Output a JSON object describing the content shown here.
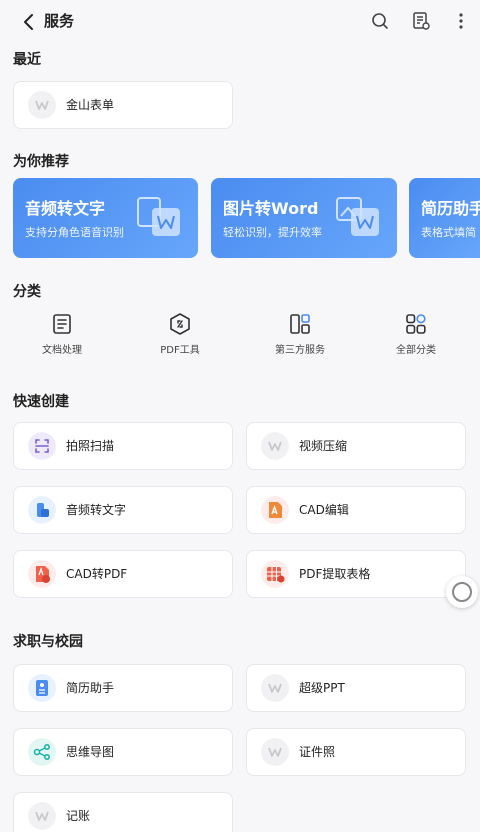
{
  "header": {
    "title": "服务"
  },
  "sections": {
    "recent": "最近",
    "recommend": "为你推荐",
    "category": "分类",
    "quick": "快速创建",
    "career": "求职与校园"
  },
  "recent": [
    {
      "label": "金山表单",
      "icon": "wps-logo-icon"
    }
  ],
  "recommend": [
    {
      "title": "音频转文字",
      "subtitle": "支持分角色语音识别"
    },
    {
      "title": "图片转Word",
      "subtitle": "轻松识别，提升效率"
    },
    {
      "title": "简历助手",
      "subtitle": "表格式填简"
    }
  ],
  "categories": [
    {
      "label": "文档处理",
      "icon": "document-icon"
    },
    {
      "label": "PDF工具",
      "icon": "pdf-tool-icon"
    },
    {
      "label": "第三方服务",
      "icon": "third-party-icon"
    },
    {
      "label": "全部分类",
      "icon": "grid-icon"
    }
  ],
  "quick": [
    {
      "label": "拍照扫描",
      "icon": "scan-icon"
    },
    {
      "label": "视频压缩",
      "icon": "wps-logo-icon"
    },
    {
      "label": "音频转文字",
      "icon": "audio-icon"
    },
    {
      "label": "CAD编辑",
      "icon": "cad-edit-icon"
    },
    {
      "label": "CAD转PDF",
      "icon": "cad-pdf-icon"
    },
    {
      "label": "PDF提取表格",
      "icon": "table-icon"
    }
  ],
  "career": [
    {
      "label": "简历助手",
      "icon": "resume-icon"
    },
    {
      "label": "超级PPT",
      "icon": "wps-logo-icon"
    },
    {
      "label": "思维导图",
      "icon": "mindmap-icon"
    },
    {
      "label": "证件照",
      "icon": "wps-logo-icon"
    },
    {
      "label": "记账",
      "icon": "wps-logo-icon"
    }
  ],
  "colors": {
    "accent": "#4a8cf0",
    "red": "#f0604a",
    "teal": "#1fb5a8"
  }
}
